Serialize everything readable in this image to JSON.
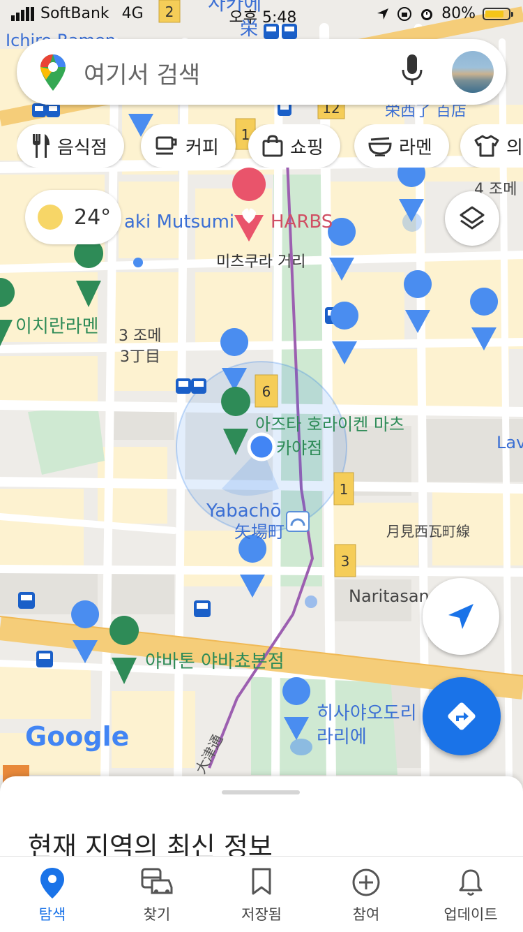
{
  "status_bar": {
    "carrier": "SoftBank",
    "network": "4G",
    "time": "오후 5:48",
    "battery": "80%",
    "battery_level": 0.8
  },
  "search": {
    "placeholder": "여기서 검색"
  },
  "chips": [
    {
      "label": "음식점",
      "icon": "fork-knife-icon"
    },
    {
      "label": "커피",
      "icon": "coffee-cup-icon"
    },
    {
      "label": "쇼핑",
      "icon": "shopping-bag-icon"
    },
    {
      "label": "라멘",
      "icon": "ramen-bowl-icon"
    },
    {
      "label": "의류",
      "icon": "tshirt-icon"
    }
  ],
  "weather": {
    "temp": "24°"
  },
  "map_labels": {
    "top_sign": "사카에",
    "sakae": "栄",
    "ichiro": "Ichiro Ramen",
    "dept_store": "栄西了 百店",
    "aki": "aki Mutsumi",
    "harbs": "HARBS",
    "jome4": "4 조메",
    "michikura": "미츠쿠라 거리",
    "ichiran": "이치란라멘",
    "jome3": "3 조메",
    "chome3": "3丁目",
    "astra1": "아즈타 호라이켄 마츠",
    "astra2": "카야점",
    "yabacho_en": "Yabachō",
    "yabacho_jp": "矢場町",
    "tsukimi": "月見西瓦町線",
    "naritasan": "Naritasan",
    "yabaton": "야바톤 야바쵸본점",
    "hisaya1": "히사야오도리",
    "hisaya2": "라리에",
    "google": "Google",
    "lav": "Lav",
    "road": "大津通",
    "badge_2": "2",
    "badge_12": "12",
    "badge_1a": "1",
    "badge_6": "6",
    "badge_1b": "1",
    "badge_3": "3"
  },
  "sheet": {
    "title": "현재 지역의 최신 정보"
  },
  "tabs": [
    {
      "label": "탐색",
      "icon": "explore-pin-icon",
      "active": true
    },
    {
      "label": "찾기",
      "icon": "commute-icon",
      "active": false
    },
    {
      "label": "저장됨",
      "icon": "bookmark-icon",
      "active": false
    },
    {
      "label": "참여",
      "icon": "add-circle-icon",
      "active": false
    },
    {
      "label": "업데이트",
      "icon": "bell-icon",
      "active": false
    }
  ],
  "colors": {
    "accent": "#1a73e8",
    "park": "#cfe9d2",
    "block": "#fdf2d0",
    "main_road": "#f5cd79",
    "metro": "#9c5fb0"
  }
}
